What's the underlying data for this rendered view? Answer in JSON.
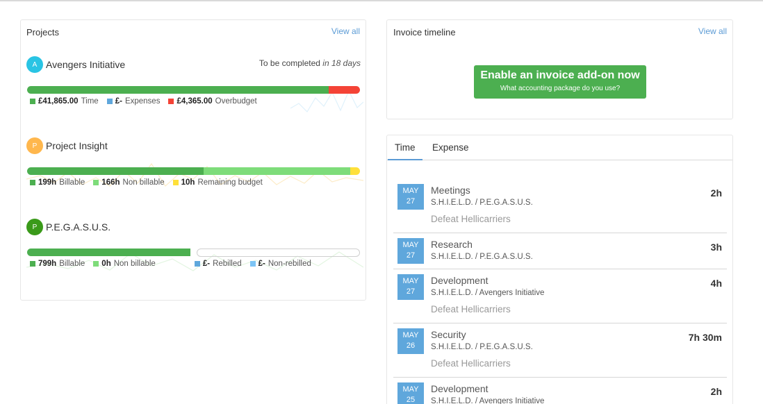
{
  "projects": {
    "title": "Projects",
    "view_all": "View all",
    "items": [
      {
        "initial": "A",
        "avatar_color": "#29c4e4",
        "name": "Avengers Initiative",
        "due_prefix": "To be completed",
        "due_value": "in 18 days",
        "bar": [
          {
            "fraction": 0.906,
            "color": "#4caf50"
          },
          {
            "fraction": 0.094,
            "color": "#f44336"
          }
        ],
        "legend": [
          {
            "value": "£41,865.00",
            "label": "Time",
            "color": "#4caf50"
          },
          {
            "value": "£-",
            "label": "Expenses",
            "color": "#5fa7dc"
          },
          {
            "value": "£4,365.00",
            "label": "Overbudget",
            "color": "#f44336"
          }
        ]
      },
      {
        "initial": "P",
        "avatar_color": "#ffb74d",
        "name": "Project Insight",
        "bar": [
          {
            "fraction": 0.53,
            "color": "#4caf50"
          },
          {
            "fraction": 0.44,
            "color": "#7edc7a"
          },
          {
            "fraction": 0.03,
            "color": "#ffe03a"
          }
        ],
        "legend": [
          {
            "value": "199h",
            "label": "Billable",
            "color": "#4caf50"
          },
          {
            "value": "166h",
            "label": "Non billable",
            "color": "#7edc7a"
          },
          {
            "value": "10h",
            "label": "Remaining budget",
            "color": "#ffe03a"
          }
        ]
      },
      {
        "initial": "P",
        "avatar_color": "#3a9a1a",
        "name": "P.E.G.A.S.U.S.",
        "bar": [
          {
            "fraction": 0.49,
            "color": "#4caf50"
          }
        ],
        "legend": [
          {
            "value": "799h",
            "label": "Billable",
            "color": "#4caf50"
          },
          {
            "value": "0h",
            "label": "Non billable",
            "color": "#7edc7a"
          },
          {
            "value": "£-",
            "label": "Rebilled",
            "color": "#5fa7dc"
          },
          {
            "value": "£-",
            "label": "Non-rebilled",
            "color": "#7cc4f5"
          }
        ]
      }
    ]
  },
  "invoice": {
    "title": "Invoice timeline",
    "view_all": "View all",
    "cta_main": "Enable an invoice add-on now",
    "cta_sub": "What accounting package do you use?"
  },
  "entries": {
    "tabs": [
      "Time",
      "Expense"
    ],
    "active_tab": "Time",
    "items": [
      {
        "month": "MAY",
        "day": "27",
        "title": "Meetings",
        "client": "S.H.I.E.L.D. / P.E.G.A.S.U.S.",
        "task": "Defeat Hellicarriers",
        "hours": "2h"
      },
      {
        "month": "MAY",
        "day": "27",
        "title": "Research",
        "client": "S.H.I.E.L.D. / P.E.G.A.S.U.S.",
        "task": "",
        "hours": "3h"
      },
      {
        "month": "MAY",
        "day": "27",
        "title": "Development",
        "client": "S.H.I.E.L.D. / Avengers Initiative",
        "task": "Defeat Hellicarriers",
        "hours": "4h"
      },
      {
        "month": "MAY",
        "day": "26",
        "title": "Security",
        "client": "S.H.I.E.L.D. / P.E.G.A.S.U.S.",
        "task": "Defeat Hellicarriers",
        "hours": "7h 30m"
      },
      {
        "month": "MAY",
        "day": "25",
        "title": "Development",
        "client": "S.H.I.E.L.D. / Avengers Initiative",
        "task": "",
        "hours": "2h"
      }
    ]
  }
}
